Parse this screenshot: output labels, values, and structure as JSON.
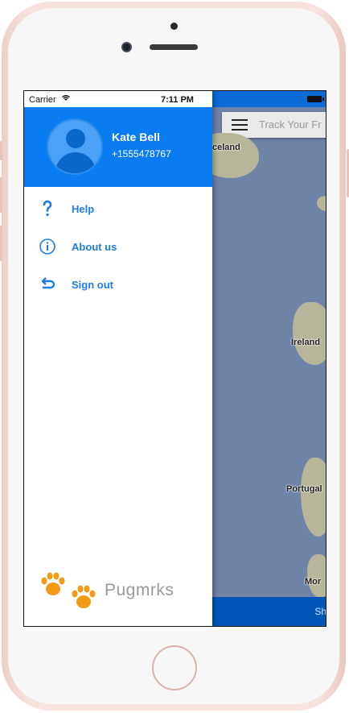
{
  "status_bar": {
    "carrier": "Carrier",
    "time": "7:11 PM"
  },
  "profile": {
    "name": "Kate Bell",
    "phone": "+1555478767"
  },
  "menu": [
    {
      "label": "Help",
      "icon": "question-icon"
    },
    {
      "label": "About us",
      "icon": "info-icon"
    },
    {
      "label": "Sign out",
      "icon": "sign-out-icon"
    }
  ],
  "brand": {
    "name": "Pugmrks"
  },
  "map": {
    "search_placeholder": "Track Your Fr",
    "places": [
      "celand",
      "Ireland",
      "Portugal",
      "Mor"
    ],
    "bottom_button": "Sh"
  },
  "colors": {
    "accent": "#0a7cf2",
    "menu_text": "#1e7de6",
    "paw": "#f39a16"
  }
}
